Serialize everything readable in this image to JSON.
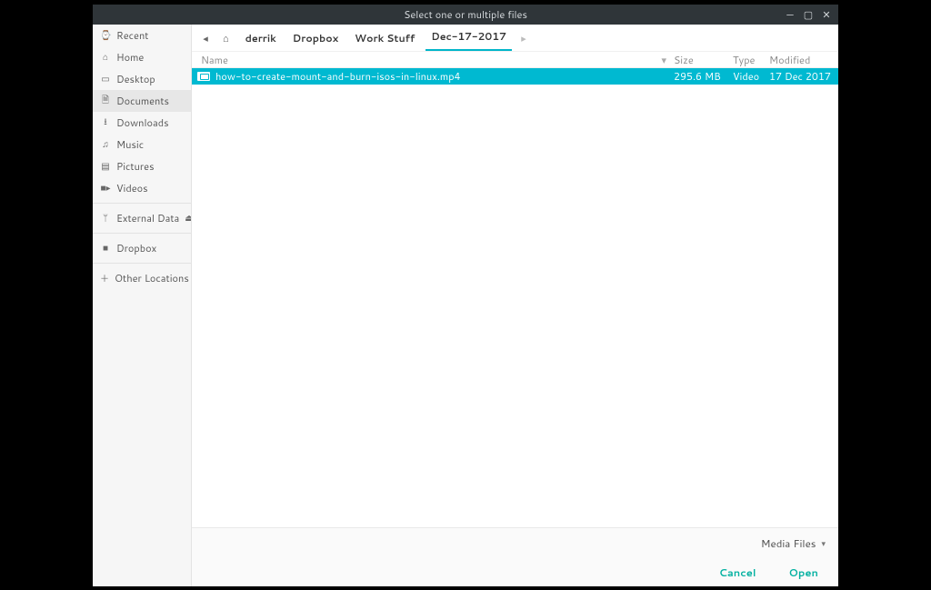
{
  "window": {
    "title": "Select one or multiple files"
  },
  "sidebar": {
    "items": [
      {
        "icon": "⌚",
        "label": "Recent"
      },
      {
        "icon": "⌂",
        "label": "Home"
      },
      {
        "icon": "▭",
        "label": "Desktop"
      },
      {
        "icon": "🗎",
        "label": "Documents"
      },
      {
        "icon": "⭳",
        "label": "Downloads"
      },
      {
        "icon": "♫",
        "label": "Music"
      },
      {
        "icon": "▤",
        "label": "Pictures"
      },
      {
        "icon": "■▸",
        "label": "Videos"
      }
    ],
    "external": {
      "icon": "ᛘ",
      "label": "External Data",
      "eject": "⏏"
    },
    "dropbox": {
      "icon": "■",
      "label": "Dropbox"
    },
    "other": {
      "icon": "＋",
      "label": "Other Locations"
    }
  },
  "path": {
    "back": "◂",
    "home": "⌂",
    "crumbs": [
      "derrik",
      "Dropbox",
      "Work Stuff",
      "Dec-17-2017"
    ],
    "fwd": "▸"
  },
  "columns": {
    "name": "Name",
    "sort": "▾",
    "size": "Size",
    "type": "Type",
    "modified": "Modified"
  },
  "files": [
    {
      "name": "how-to-create-mount-and-burn-isos-in-linux.mp4",
      "size": "295.6 MB",
      "type": "Video",
      "modified": "17 Dec 2017"
    }
  ],
  "footer": {
    "filter": "Media Files",
    "caret": "▾",
    "cancel": "Cancel",
    "open": "Open"
  }
}
